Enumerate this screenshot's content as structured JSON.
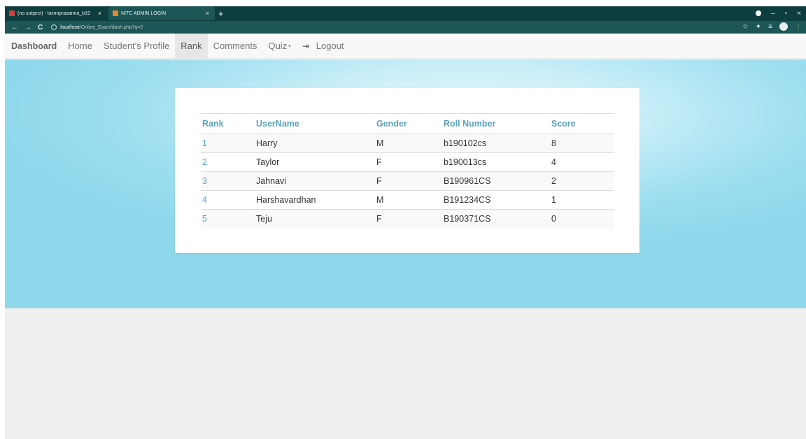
{
  "browser": {
    "tabs": [
      {
        "title": "(no subject) - laxmiprasanna_b19",
        "close": "×"
      },
      {
        "title": "NITC ADMIN LOGIN",
        "close": "×"
      }
    ],
    "new_tab": "+",
    "window_controls": {
      "minimize": "–",
      "maximize": "▫",
      "close": "×"
    },
    "nav": {
      "back": "←",
      "forward": "→",
      "reload": "C"
    },
    "address": {
      "host": "localhost",
      "path": "/Online_Exam/dash.php?q=2"
    },
    "toolbar_icons": {
      "star": "☆",
      "extensions": "✦",
      "menu_list": "≡",
      "more": "⋮"
    }
  },
  "sitenav": {
    "brand": "Dashboard",
    "items": [
      {
        "label": "Home"
      },
      {
        "label": "Student's Profile"
      },
      {
        "label": "Rank"
      },
      {
        "label": "Comments"
      },
      {
        "label": "Quiz"
      }
    ],
    "logout": "Logout",
    "quiz_caret": "▾",
    "logout_icon": "⇥"
  },
  "rank_table": {
    "headers": [
      "Rank",
      "UserName",
      "Gender",
      "Roll Number",
      "Score"
    ],
    "rows": [
      {
        "rank": "1",
        "username": "Harry",
        "gender": "M",
        "roll": "b190102cs",
        "score": "8"
      },
      {
        "rank": "2",
        "username": "Taylor",
        "gender": "F",
        "roll": "b190013cs",
        "score": "4"
      },
      {
        "rank": "3",
        "username": "Jahnavi",
        "gender": "F",
        "roll": "B190961CS",
        "score": "2"
      },
      {
        "rank": "4",
        "username": "Harshavardhan",
        "gender": "M",
        "roll": "B191234CS",
        "score": "1"
      },
      {
        "rank": "5",
        "username": "Teju",
        "gender": "F",
        "roll": "B190371CS",
        "score": "0"
      }
    ]
  },
  "colors": {
    "chrome": "#0d3d3d",
    "accent_header": "#5aa3bb",
    "hero": "#9fdff0",
    "footer_bg": "#eeeeee"
  }
}
